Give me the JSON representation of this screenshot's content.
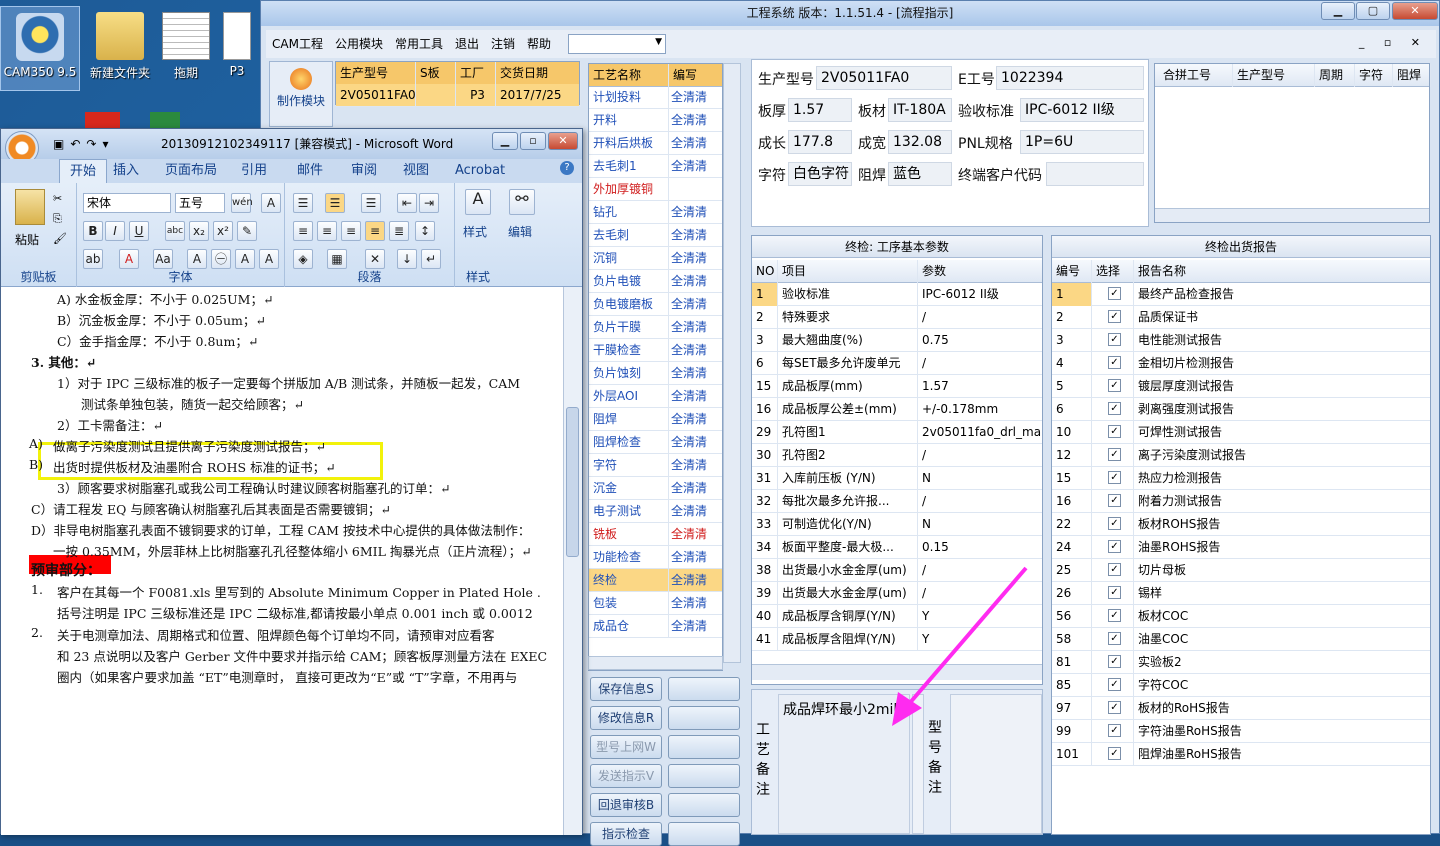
{
  "desktop": {
    "icons": [
      {
        "label": "CAM350 9.5"
      },
      {
        "label": "新建文件夹"
      },
      {
        "label": "拖期"
      },
      {
        "label": "P3"
      }
    ]
  },
  "app": {
    "title": "工程系统  版本：1.1.51.4 - [流程指示]",
    "menu": [
      "CAM工程",
      "公用模块",
      "常用工具",
      "退出",
      "注销",
      "帮助"
    ],
    "side_button": "制作模块",
    "orders": {
      "headers": [
        "生产型号",
        "S板",
        "工厂",
        "交货日期"
      ],
      "rows": [
        [
          "2V05011FA0",
          "",
          "P3",
          "2017/7/25"
        ]
      ]
    },
    "process": {
      "headers": [
        "工艺名称",
        "编写"
      ],
      "rows": [
        [
          "计划投料",
          "全清清"
        ],
        [
          "开料",
          "全清清"
        ],
        [
          "开料后烘板",
          "全清清"
        ],
        [
          "去毛刺1",
          "全清清"
        ],
        [
          "外加厚镀铜",
          ""
        ],
        [
          "钻孔",
          "全清清"
        ],
        [
          "去毛刺",
          "全清清"
        ],
        [
          "沉铜",
          "全清清"
        ],
        [
          "负片电镀",
          "全清清"
        ],
        [
          "负电镀磨板",
          "全清清"
        ],
        [
          "负片干膜",
          "全清清"
        ],
        [
          "干膜检查",
          "全清清"
        ],
        [
          "负片蚀刻",
          "全清清"
        ],
        [
          "外层AOI",
          "全清清"
        ],
        [
          "阻焊",
          "全清清"
        ],
        [
          "阻焊检查",
          "全清清"
        ],
        [
          "字符",
          "全清清"
        ],
        [
          "沉金",
          "全清清"
        ],
        [
          "电子测试",
          "全清清"
        ],
        [
          "铣板",
          "全清清"
        ],
        [
          "功能检查",
          "全清清"
        ],
        [
          "终检",
          "全清清"
        ],
        [
          "包装",
          "全清清"
        ],
        [
          "成品仓",
          "全清清"
        ]
      ]
    },
    "buttons": [
      "保存信息S",
      "修改信息R",
      "型号上网W",
      "发送指示V",
      "回退审核B",
      "指示检查"
    ],
    "info": {
      "model_label": "生产型号",
      "model": "2V05011FA0",
      "eno_label": "E工号",
      "eno": "1022394",
      "thick_label": "板厚",
      "thick": "1.57",
      "mat_label": "板材",
      "mat": "IT-180A",
      "std_label": "验收标准",
      "std": "IPC-6012 II级",
      "len_label": "成长",
      "len": "177.8",
      "wid_label": "成宽",
      "wid": "132.08",
      "pnl_label": "PNL规格",
      "pnl": "1P=6U",
      "char_label": "字符",
      "char": "白色字符",
      "mask_label": "阻焊",
      "mask": "蓝色",
      "cust_label": "终端客户代码",
      "cust": ""
    },
    "merge_headers": [
      "合拼工号",
      "生产型号",
      "周期",
      "字符",
      "阻焊"
    ],
    "params": {
      "title": "终检: 工序基本参数",
      "headers": [
        "NO",
        "项目",
        "参数"
      ],
      "rows": [
        [
          "1",
          "验收标准",
          "IPC-6012 II级"
        ],
        [
          "2",
          "特殊要求",
          "/"
        ],
        [
          "3",
          "最大翘曲度(%)",
          "0.75"
        ],
        [
          "6",
          "每SET最多允许废单元",
          "/"
        ],
        [
          "15",
          "成品板厚(mm)",
          "1.57"
        ],
        [
          "16",
          "成品板厚公差±(mm)",
          "+/-0.178mm"
        ],
        [
          "29",
          "孔符图1",
          "2v05011fa0_drl_ma"
        ],
        [
          "30",
          "孔符图2",
          "/"
        ],
        [
          "31",
          "入库前压板 (Y/N)",
          "N"
        ],
        [
          "32",
          "每批次最多允许报...",
          "/"
        ],
        [
          "33",
          "可制造优化(Y/N)",
          "N"
        ],
        [
          "34",
          "板面平整度-最大极...",
          "0.15"
        ],
        [
          "38",
          "出货最小水金金厚(um)",
          "/"
        ],
        [
          "39",
          "出货最大水金金厚(um)",
          "/"
        ],
        [
          "40",
          "成品板厚含铜厚(Y/N)",
          "Y"
        ],
        [
          "41",
          "成品板厚含阻焊(Y/N)",
          "Y"
        ]
      ]
    },
    "reports": {
      "title": "终检出货报告",
      "headers": [
        "编号",
        "选择",
        "报告名称"
      ],
      "rows": [
        [
          "1",
          "最终产品检查报告"
        ],
        [
          "2",
          "品质保证书"
        ],
        [
          "3",
          "电性能测试报告"
        ],
        [
          "4",
          "金相切片检测报告"
        ],
        [
          "5",
          "镀层厚度测试报告"
        ],
        [
          "6",
          "剥离强度测试报告"
        ],
        [
          "10",
          "可焊性测试报告"
        ],
        [
          "12",
          "离子污染度测试报告"
        ],
        [
          "15",
          "热应力检测报告"
        ],
        [
          "16",
          "附着力测试报告"
        ],
        [
          "22",
          "板材ROHS报告"
        ],
        [
          "24",
          "油墨ROHS报告"
        ],
        [
          "25",
          "切片母板"
        ],
        [
          "26",
          "锡样"
        ],
        [
          "56",
          "板材COC"
        ],
        [
          "58",
          "油墨COC"
        ],
        [
          "81",
          "实验板2"
        ],
        [
          "85",
          "字符COC"
        ],
        [
          "97",
          "板材的RoHS报告"
        ],
        [
          "99",
          "字符油墨RoHS报告"
        ],
        [
          "101",
          "阻焊油墨RoHS报告"
        ]
      ]
    },
    "note_label": "工艺备注",
    "note_text": "成品焊环最小2mil",
    "model_note_label": "型号备注"
  },
  "word": {
    "title": "20130912102349117 [兼容模式] - Microsoft Word",
    "tabs": [
      "开始",
      "插入",
      "页面布局",
      "引用",
      "邮件",
      "审阅",
      "视图",
      "Acrobat"
    ],
    "font": "宋体",
    "size": "五号",
    "groups": [
      "剪贴板",
      "字体",
      "段落",
      "样式",
      "编辑"
    ],
    "paste": "粘贴",
    "styles": "样式",
    "edit": "编辑",
    "lines": [
      "A)       水金板金厚：不小于 0.025UM；↵",
      "B）沉金板金厚：不小于 0.05um；↵",
      "C）金手指金厚：不小于 0.8um；↵",
      "3.  其他：↵",
      "1）对于 IPC 三级标准的板子一定要每个拼版加 A/B 测试条，并随板一起发，CAM",
      "测试条单独包装，随货一起交给顾客；↵",
      "2）工卡需备注：↵",
      "做离子污染度测试且提供离子污染度测试报告；↵",
      "出货时提供板材及油墨附合 ROHS 标准的证书；↵",
      "3）顾客要求树脂塞孔或我公司工程确认时建议顾客树脂塞孔的订单：↵",
      "C）请工程发 EQ 与顾客确认树脂塞孔后其表面是否需要镀铜；↵",
      "D）非导电树脂塞孔表面不镀铜要求的订单，工程 CAM 按技术中心提供的具体做法制作：",
      "一按 0.35MM，外层菲林上比树脂塞孔孔径整体缩小 6MIL 掏暴光点（正片流程）；↵",
      "预审部分：",
      "客户在其每一个 F0081.xls 里写到的 Absolute Minimum Copper in Plated Hole .",
      "括号注明是 IPC 三级标准还是 IPC 二级标准,都请按最小单点 0.001 inch 或 0.0012",
      "关于电测章加法、周期格式和位置、阻焊颜色每个订单均不同，请预审对应看客",
      "和 23 点说明以及客户 Gerber 文件中要求并指示给 CAM；顾客板厚测量方法在 EXEC",
      "圈内（如果客户要求加盖 “ET”电测章时， 直接可更改为“E”或 “T”字章，不用再与"
    ],
    "markers": {
      "a": "A)",
      "b": "B)",
      "n1": "1.",
      "n2": "2."
    }
  },
  "colors": {
    "highlight": "#fbd785",
    "yellow_box": "#f2f20a",
    "arrow": "#ff2bf0",
    "red_heading": "#ff0000"
  }
}
